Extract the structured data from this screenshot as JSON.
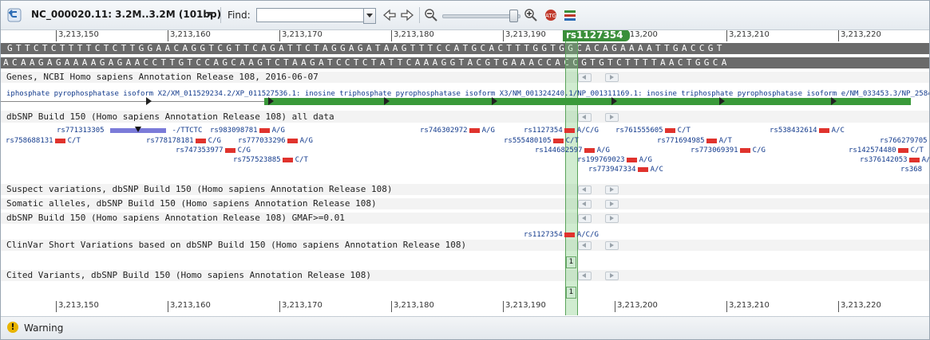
{
  "toolbar": {
    "title": "NC_000020.11: 3.2M..3.2M (101bp)",
    "find_label": "Find:",
    "find_value": "",
    "icons": [
      "back-icon",
      "title-dropdown-icon",
      "find-dropdown-icon",
      "prev-arrow-icon",
      "next-arrow-icon",
      "zoom-out-icon",
      "zoom-slider",
      "zoom-in-icon",
      "atg-icon",
      "tracks-icon"
    ]
  },
  "ruler": {
    "ticks": [
      "3,213,150",
      "3,213,160",
      "3,213,170",
      "3,213,180",
      "3,213,190",
      "3,213,200",
      "3,213,210",
      "3,213,220"
    ]
  },
  "sequence": {
    "forward": "GTTCTCTTTTCTCTTGGAACAGGTCGTTCAGATTCTAGGAGATAAGTTTCCATGCACTTTGGTGGCACAGAAAATTGACCGT",
    "reverse": "ACAAGAGAAAAGAGAACCTTGTCCAGCAAGTCTAAGATCCTCTATTCAAAGGTACGTGAAACCACCGTGTCTTTTAACTGGCA"
  },
  "highlight": {
    "label": "rs1127354"
  },
  "tracks": {
    "genes": {
      "title": "Genes, NCBI Homo sapiens Annotation Release 108, 2016-06-07",
      "gene_label": "iphosphate pyrophosphatase isoform X2/XM_011529234.2/XP_011527536.1: inosine triphosphate pyrophosphatase isoform X3/NM_001324240.1/NP_001311169.1: inosine triphosphate pyrophosphatase isoform e/NM_033453.3/NP_258412.1: inosine"
    },
    "dbsnp_all": {
      "title": "dbSNP Build 150 (Homo sapiens Annotation Release 108) all data",
      "items": [
        {
          "id": "rs771313305",
          "allele": "-/TTCTC"
        },
        {
          "id": "rs983098781",
          "allele": "A/G"
        },
        {
          "id": "rs746302972",
          "allele": "A/G"
        },
        {
          "id": "rs1127354",
          "allele": "A/C/G"
        },
        {
          "id": "rs761555605",
          "allele": "C/T"
        },
        {
          "id": "rs538432614",
          "allele": "A/C"
        },
        {
          "id": "rs766279705",
          "allele": ""
        },
        {
          "id": "rs758688131",
          "allele": "C/T"
        },
        {
          "id": "rs778178181",
          "allele": "C/G"
        },
        {
          "id": "rs777033296",
          "allele": "A/G"
        },
        {
          "id": "rs555480105",
          "allele": "C/T"
        },
        {
          "id": "rs771694985",
          "allele": "A/T"
        },
        {
          "id": "rs142574480",
          "allele": "C/T"
        },
        {
          "id": "rs747353977",
          "allele": "C/G"
        },
        {
          "id": "rs144682597",
          "allele": "A/G"
        },
        {
          "id": "rs773069391",
          "allele": "C/G"
        },
        {
          "id": "rs376142053",
          "allele": "A/"
        },
        {
          "id": "rs757523885",
          "allele": "C/T"
        },
        {
          "id": "rs199769023",
          "allele": "A/G"
        },
        {
          "id": "rs368",
          "allele": ""
        },
        {
          "id": "rs773947334",
          "allele": "A/C"
        }
      ]
    },
    "suspect": {
      "title": "Suspect variations, dbSNP Build 150 (Homo sapiens Annotation Release 108)"
    },
    "somatic": {
      "title": "Somatic alleles, dbSNP Build 150 (Homo sapiens Annotation Release 108)"
    },
    "gmaf": {
      "title": "dbSNP Build 150 (Homo sapiens Annotation Release 108) GMAF>=0.01",
      "items": [
        {
          "id": "rs1127354",
          "allele": "A/C/G"
        }
      ]
    },
    "clinvar": {
      "title": "ClinVar Short Variations based on dbSNP Build 150 (Homo sapiens Annotation Release 108)",
      "count": "1"
    },
    "cited": {
      "title": "Cited Variants, dbSNP Build 150 (Homo sapiens Annotation Release 108)",
      "count": "1"
    }
  },
  "status": {
    "text": "Warning"
  }
}
